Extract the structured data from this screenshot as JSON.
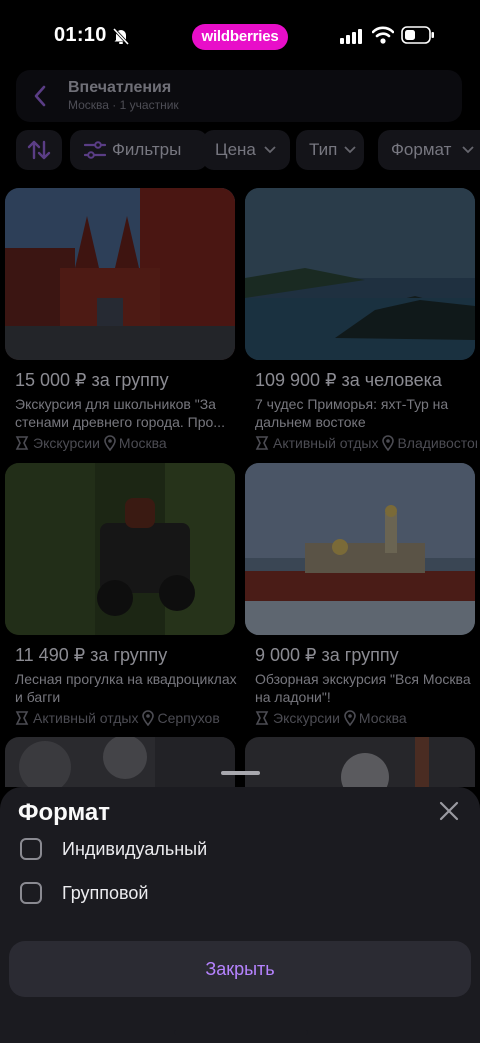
{
  "status_bar": {
    "time": "01:10",
    "brand": "wildberries",
    "brand_color": "#e80ec9",
    "icons": [
      "bell-off-icon",
      "signal-icon",
      "wifi-icon",
      "battery-icon"
    ]
  },
  "header": {
    "title": "Впечатления",
    "subtitle": "Москва · 1 участник"
  },
  "filters": {
    "filters_label": "Фильтры",
    "price_label": "Цена",
    "type_label": "Тип",
    "format_label": "Формат"
  },
  "products": [
    {
      "price": "15 000 ₽ за группу",
      "title": "Экскурсия для школьников \"За стенами древнего города. Про...",
      "category": "Экскурсии",
      "city": "Москва"
    },
    {
      "price": "109 900 ₽ за человека",
      "title": "7 чудес Приморья: яхт-Тур на дальнем востоке",
      "category": "Активный отдых",
      "city": "Владивосток"
    },
    {
      "price": "11 490 ₽ за группу",
      "title": "Лесная прогулка на квадроциклах и багги",
      "category": "Активный отдых",
      "city": "Серпухов"
    },
    {
      "price": "9 000 ₽ за группу",
      "title": "Обзорная экскурсия \"Вся Москва на ладони\"!",
      "category": "Экскурсии",
      "city": "Москва"
    }
  ],
  "sheet": {
    "title": "Формат",
    "options": [
      {
        "label": "Индивидуальный",
        "checked": false
      },
      {
        "label": "Групповой",
        "checked": false
      }
    ],
    "close_button": "Закрыть",
    "accent_color": "#b683ff"
  }
}
